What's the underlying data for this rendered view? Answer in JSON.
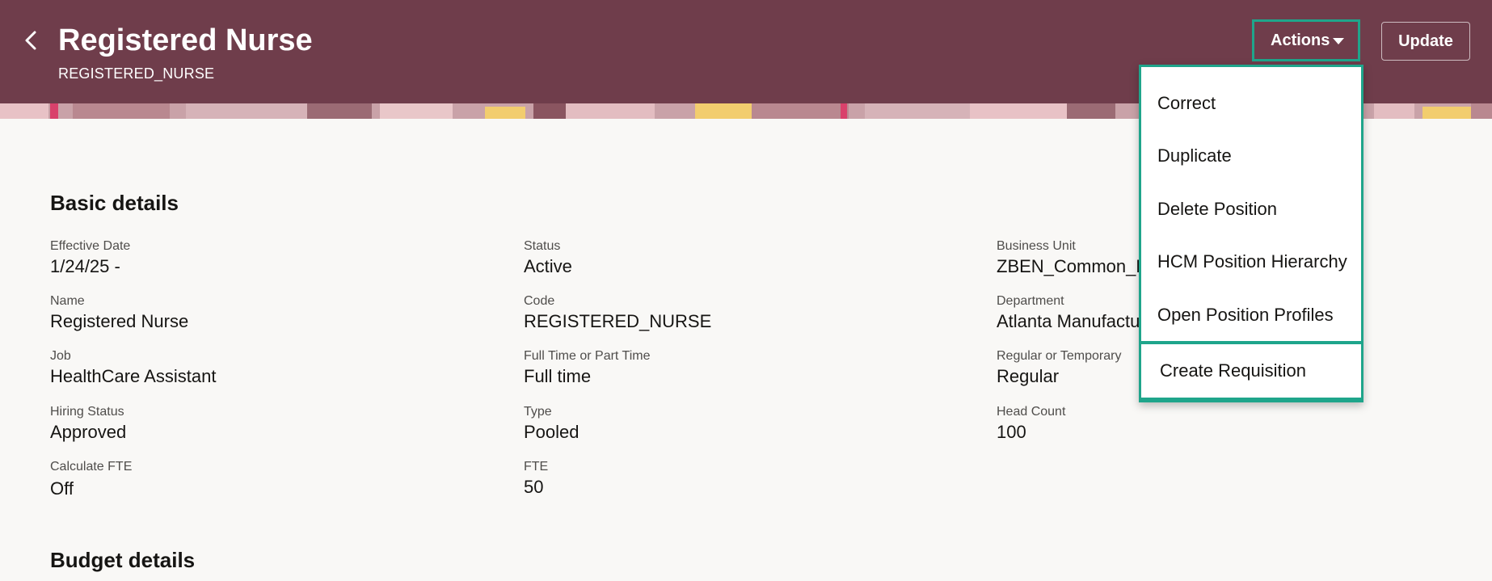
{
  "header": {
    "title": "Registered Nurse",
    "subtitle": "REGISTERED_NURSE",
    "back_icon": "chevron-left-icon",
    "actions_label": "Actions",
    "actions_icon": "caret-down-icon",
    "update_label": "Update",
    "colors": {
      "background": "#6f3d4b",
      "highlight": "#1fa58b"
    }
  },
  "actions_menu": {
    "items": [
      {
        "label": "Correct"
      },
      {
        "label": "Duplicate"
      },
      {
        "label": "Delete Position"
      },
      {
        "label": "HCM Position Hierarchy"
      },
      {
        "label": "Open Position Profiles"
      },
      {
        "label": "Create Requisition"
      }
    ]
  },
  "basic_details": {
    "title": "Basic details",
    "fields": {
      "effective_date": {
        "label": "Effective Date",
        "value": "1/24/25 -"
      },
      "status": {
        "label": "Status",
        "value": "Active"
      },
      "business_unit": {
        "label": "Business Unit",
        "value": "ZBEN_Common_B"
      },
      "name": {
        "label": "Name",
        "value": "Registered Nurse"
      },
      "code": {
        "label": "Code",
        "value": "REGISTERED_NURSE"
      },
      "department": {
        "label": "Department",
        "value": "Atlanta Manufactu"
      },
      "job": {
        "label": "Job",
        "value": "HealthCare Assistant"
      },
      "full_part_time": {
        "label": "Full Time or Part Time",
        "value": "Full time"
      },
      "regular_temporary": {
        "label": "Regular or Temporary",
        "value": "Regular"
      },
      "hiring_status": {
        "label": "Hiring Status",
        "value": "Approved"
      },
      "type": {
        "label": "Type",
        "value": "Pooled"
      },
      "head_count": {
        "label": "Head Count",
        "value": "100"
      },
      "calculate_fte": {
        "label": "Calculate FTE",
        "value": "Off"
      },
      "fte": {
        "label": "FTE",
        "value": "50"
      }
    }
  },
  "budget_details": {
    "title": "Budget details"
  }
}
